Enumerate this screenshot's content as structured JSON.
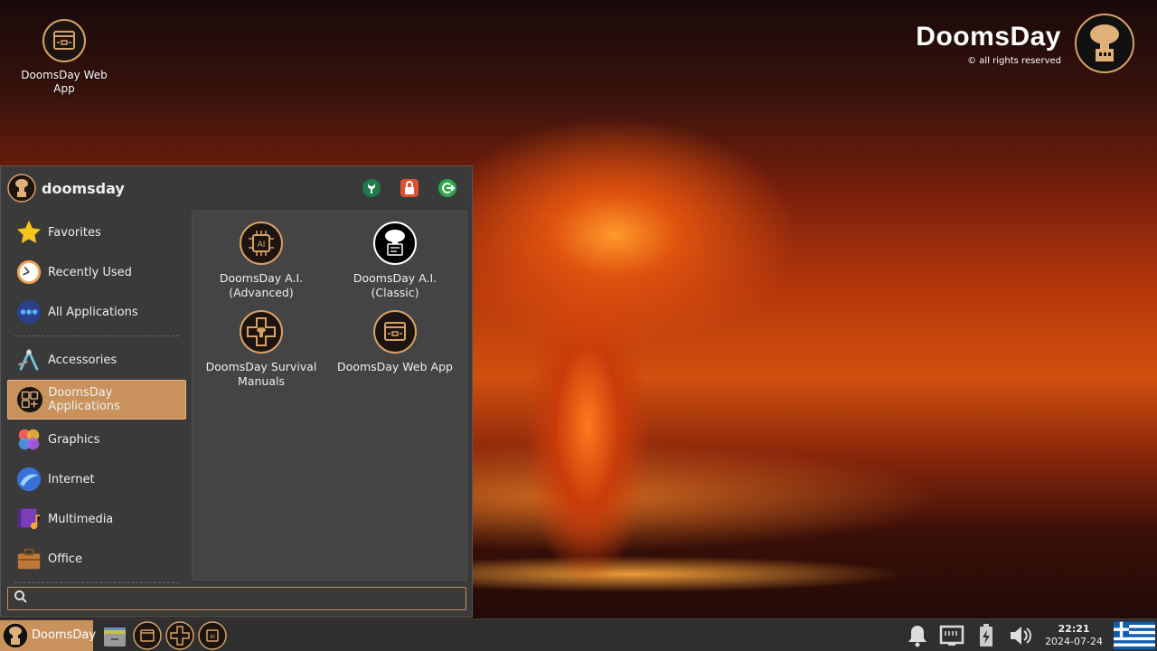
{
  "desktop": {
    "icons": [
      {
        "label": "DoomsDay Web App",
        "icon": "web-app-icon"
      }
    ],
    "brand": {
      "name": "DoomsDay",
      "rights": "© all rights reserved"
    }
  },
  "menu": {
    "user": "doomsday",
    "header_actions": [
      "settings-icon",
      "lock-icon",
      "logout-icon"
    ],
    "categories": [
      {
        "label": "Favorites",
        "icon": "star-icon"
      },
      {
        "label": "Recently Used",
        "icon": "clock-icon"
      },
      {
        "label": "All Applications",
        "icon": "dots-icon"
      },
      {
        "label": "Accessories",
        "icon": "accessories-icon"
      },
      {
        "label": "DoomsDay Applications",
        "icon": "doomsday-apps-icon",
        "active": true
      },
      {
        "label": "Graphics",
        "icon": "graphics-icon"
      },
      {
        "label": "Internet",
        "icon": "internet-icon"
      },
      {
        "label": "Multimedia",
        "icon": "multimedia-icon"
      },
      {
        "label": "Office",
        "icon": "office-icon"
      }
    ],
    "apps": [
      {
        "label_line1": "DoomsDay A.I.",
        "label_line2": "(Advanced)",
        "icon": "ai-chip-icon"
      },
      {
        "label_line1": "DoomsDay A.I.",
        "label_line2": "(Classic)",
        "icon": "mushroom-chat-icon"
      },
      {
        "label_line1": "DoomsDay Survival",
        "label_line2": "Manuals",
        "icon": "survival-cross-icon"
      },
      {
        "label_line1": "DoomsDay Web App",
        "label_line2": "",
        "icon": "web-app-icon"
      }
    ],
    "search": {
      "placeholder": "",
      "value": ""
    }
  },
  "taskbar": {
    "start_label": "DoomsDay",
    "clock_time": "22:21",
    "clock_date": "2024-07-24",
    "tray": [
      "bell-icon",
      "network-icon",
      "power-icon",
      "volume-icon"
    ],
    "flag": "greece-flag-icon"
  },
  "colors": {
    "accent": "#c9925c",
    "menu_bg": "#3a3a3a",
    "panel_bg": "#444444",
    "taskbar_bg": "#2f2f2f"
  }
}
